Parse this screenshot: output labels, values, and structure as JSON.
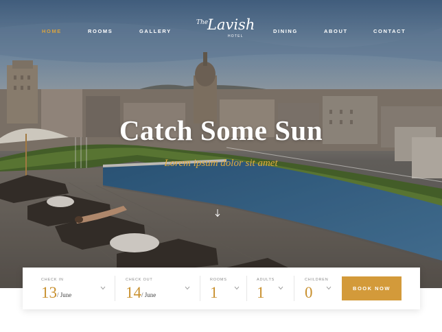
{
  "nav": {
    "items": [
      {
        "label": "HOME",
        "active": true
      },
      {
        "label": "ROOMS",
        "active": false
      },
      {
        "label": "GALLERY",
        "active": false
      },
      {
        "label": "DINING",
        "active": false
      },
      {
        "label": "ABOUT",
        "active": false
      },
      {
        "label": "CONTACT",
        "active": false
      }
    ]
  },
  "logo": {
    "the": "The",
    "name": "Lavish",
    "sub": "HOTEL"
  },
  "hero": {
    "title": "Catch Some Sun",
    "subtitle": "Lorem ipsum dolor sit amet"
  },
  "booking": {
    "check_in": {
      "label": "CHECK IN",
      "day": "13",
      "month": "/ June"
    },
    "check_out": {
      "label": "CHECK OUT",
      "day": "14",
      "month": "/ June"
    },
    "rooms": {
      "label": "ROOMS",
      "value": "1"
    },
    "adults": {
      "label": "ADULTS",
      "value": "1"
    },
    "children": {
      "label": "CHILDREN",
      "value": "0"
    },
    "button": "BOOK NOW"
  },
  "colors": {
    "accent": "#d39a3a",
    "nav_active": "#d9a441"
  },
  "icons": {
    "chevron": "chevron-down-icon",
    "scroll": "arrow-down-icon"
  }
}
